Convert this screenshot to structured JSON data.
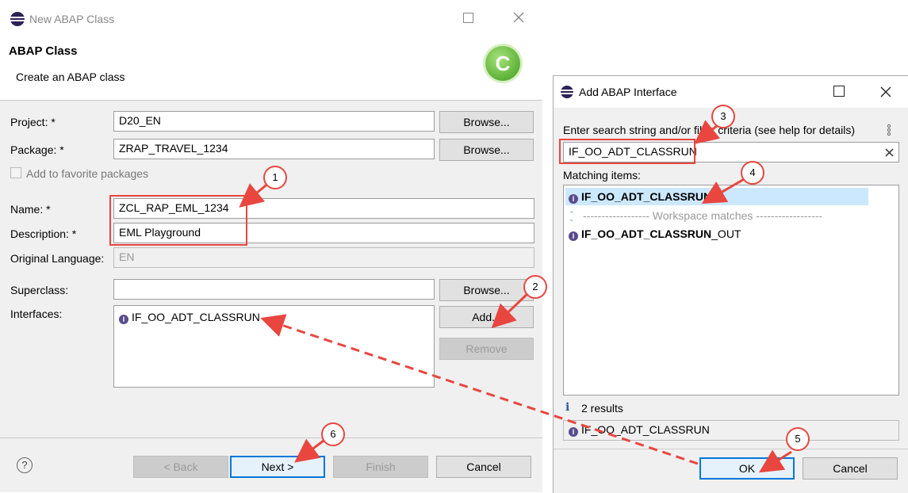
{
  "main_dialog": {
    "title": "New ABAP Class",
    "header_title": "ABAP Class",
    "header_subtitle": "Create an ABAP class",
    "project_label": "Project: *",
    "project_value": "D20_EN",
    "package_label": "Package: *",
    "package_value": "ZRAP_TRAVEL_1234",
    "favorite_label": "Add to favorite packages",
    "name_label": "Name: *",
    "name_value": "ZCL_RAP_EML_1234",
    "description_label": "Description: *",
    "description_value": "EML Playground",
    "language_label": "Original Language:",
    "language_value": "EN",
    "superclass_label": "Superclass:",
    "superclass_value": "",
    "interfaces_label": "Interfaces:",
    "interfaces": [
      "IF_OO_ADT_CLASSRUN"
    ],
    "browse_label": "Browse...",
    "add_label": "Add...",
    "remove_label": "Remove",
    "back_label": "< Back",
    "next_label": "Next >",
    "finish_label": "Finish",
    "cancel_label": "Cancel",
    "help_glyph": "?",
    "logo_glyph": "C"
  },
  "interface_dialog": {
    "title": "Add ABAP Interface",
    "search_label": "Enter search string and/or filter criteria (see help for details)",
    "search_value": "IF_OO_ADT_CLASSRUN",
    "matching_label": "Matching items:",
    "items": {
      "first": "IF_OO_ADT_CLASSRUN",
      "separator": "------------------ Workspace matches ------------------",
      "second_bold": "IF_OO_ADT_CLASSRUN",
      "second_rest": "_OUT"
    },
    "results_count": "2 results",
    "selected_value": "IF_OO_ADT_CLASSRUN",
    "ok_label": "OK",
    "cancel_label": "Cancel"
  },
  "callouts": [
    "1",
    "2",
    "3",
    "4",
    "5",
    "6"
  ],
  "colors": {
    "accent": "#e8463f",
    "selection": "#cce8ff",
    "focus": "#0078d7",
    "interface_icon": "#5a4b8c"
  }
}
